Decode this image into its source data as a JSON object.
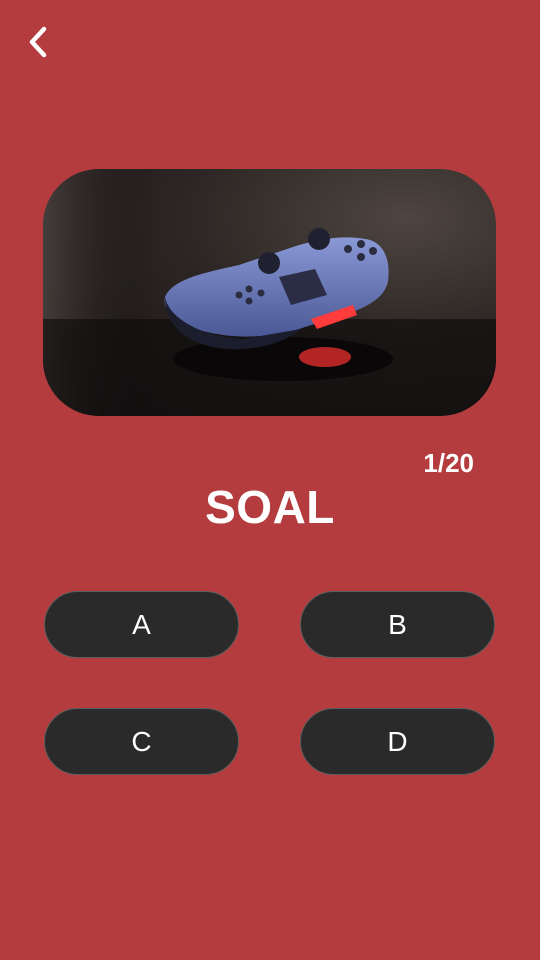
{
  "header": {
    "back_icon": "chevron-left-icon"
  },
  "question": {
    "image_subject": "game-controller-image",
    "progress": "1/20",
    "title": "SOAL"
  },
  "options": [
    {
      "label": "A"
    },
    {
      "label": "B"
    },
    {
      "label": "C"
    },
    {
      "label": "D"
    }
  ],
  "colors": {
    "background": "#b43c3e",
    "option_fill": "#2a2a2a",
    "text": "#ffffff"
  }
}
